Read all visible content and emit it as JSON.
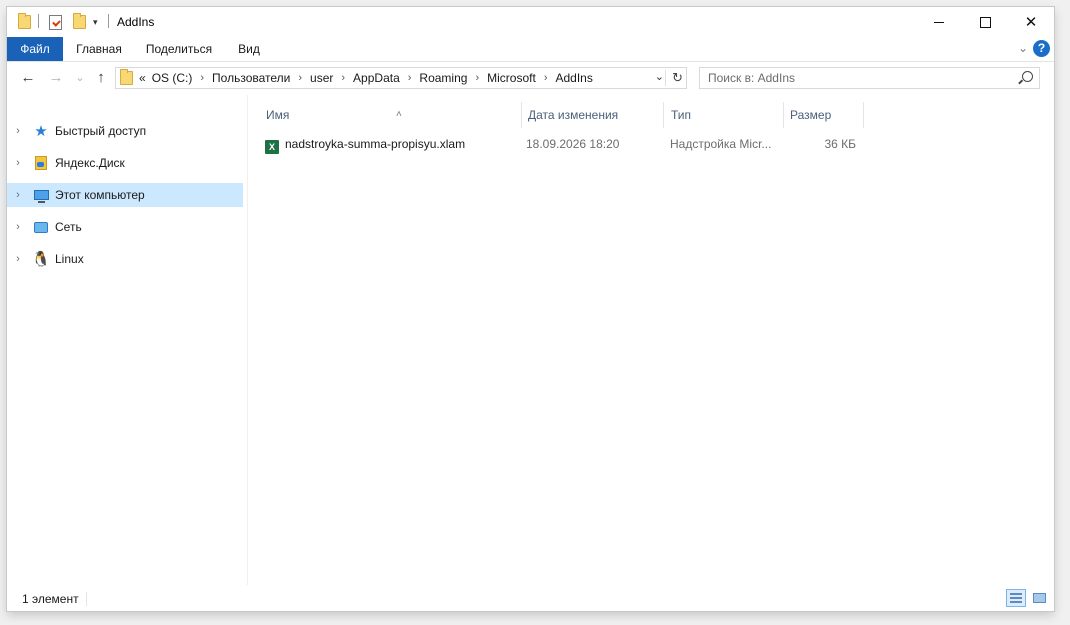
{
  "window": {
    "title": "AddIns",
    "qa_dropdown_glyph": "▾",
    "minimize_icon": "minimize-icon",
    "maximize_icon": "maximize-icon",
    "close_glyph": "✕"
  },
  "ribbon": {
    "tabs": [
      {
        "label": "Файл",
        "active": true
      },
      {
        "label": "Главная"
      },
      {
        "label": "Поделиться"
      },
      {
        "label": "Вид"
      }
    ],
    "expand_glyph": "⌄",
    "help_glyph": "?"
  },
  "navigation": {
    "back_glyph": "←",
    "forward_glyph": "→",
    "recent_glyph": "⌄",
    "up_glyph": "↑"
  },
  "address": {
    "overflow": "«",
    "crumbs": [
      "OS (C:)",
      "Пользователи",
      "user",
      "AppData",
      "Roaming",
      "Microsoft",
      "AddIns"
    ],
    "separator": "›",
    "dropdown_glyph": "⌄",
    "refresh_glyph": "↻"
  },
  "search": {
    "placeholder": "Поиск в: AddIns",
    "value": ""
  },
  "nav_pane": {
    "items": [
      {
        "label": "Быстрый доступ",
        "icon": "star-icon"
      },
      {
        "label": "Яндекс.Диск",
        "icon": "yandex-disk-icon"
      },
      {
        "label": "Этот компьютер",
        "icon": "computer-icon",
        "selected": true
      },
      {
        "label": "Сеть",
        "icon": "network-icon"
      },
      {
        "label": "Linux",
        "icon": "linux-icon"
      }
    ],
    "chevron_glyph": "›"
  },
  "columns": {
    "name": "Имя",
    "date": "Дата изменения",
    "type": "Тип",
    "size": "Размер",
    "sort_glyph": "˄"
  },
  "files": [
    {
      "name": "nadstroyka-summa-propisyu.xlam",
      "date": "18.09.2026 18:20",
      "type": "Надстройка Micr...",
      "size": "36 КБ",
      "icon": "excel-addin-icon"
    }
  ],
  "status": {
    "count": "1 элемент"
  },
  "colors": {
    "accent": "#1a62b8",
    "selection": "#cce8ff",
    "help": "#1a6ec8",
    "excel": "#1e7145",
    "folder": "#f8d775"
  }
}
